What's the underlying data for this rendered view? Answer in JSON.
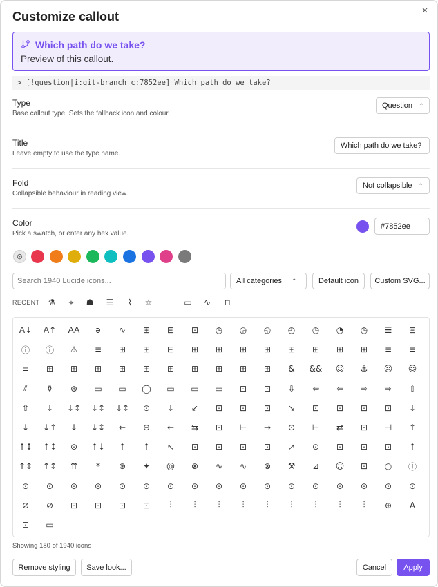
{
  "dialog": {
    "title": "Customize callout",
    "close_glyph": "×"
  },
  "preview": {
    "title": "Which path do we take?",
    "body": "Preview of this callout.",
    "icon": "git-branch-icon",
    "accent": "#7852ee"
  },
  "code": "> [!question|i:git-branch c:7852ee] Which path do we take?",
  "settings": {
    "type": {
      "label": "Type",
      "desc": "Base callout type. Sets the fallback icon and colour.",
      "value": "Question"
    },
    "title": {
      "label": "Title",
      "desc": "Leave empty to use the type name.",
      "value": "Which path do we take?"
    },
    "fold": {
      "label": "Fold",
      "desc": "Collapsible behaviour in reading view.",
      "value": "Not collapsible"
    },
    "color": {
      "label": "Color",
      "desc": "Pick a swatch, or enter any hex value.",
      "value": "#7852ee"
    }
  },
  "swatches": [
    "#e8374d",
    "#f07d1a",
    "#dfae0c",
    "#1ab85a",
    "#0fbfbf",
    "#1a73e0",
    "#7852ee",
    "#e0408a",
    "#7a7a7a"
  ],
  "icon_search": {
    "placeholder": "Search 1940 Lucide icons...",
    "category": "All categories",
    "default_icon": "Default icon",
    "custom_svg": "Custom SVG..."
  },
  "recent": {
    "label": "RECENT",
    "glyphs": [
      "⚗",
      "⌖",
      "☗",
      "☰",
      "⌇",
      "☆",
      "▭",
      "∿",
      "⊓"
    ]
  },
  "grid_glyphs": [
    "A↓",
    "A↑",
    "AA",
    "ə",
    "∿",
    "⊞",
    "⊟",
    "⊡",
    "◷",
    "◶",
    "◵",
    "◴",
    "◷",
    "◔",
    "◷",
    "☰",
    "⊟",
    "ⓘ",
    "ⓘ",
    "⚠",
    "≡",
    "⊞",
    "⊞",
    "⊟",
    "⊞",
    "⊞",
    "⊞",
    "⊞",
    "⊞",
    "⊞",
    "⊞",
    "⊞",
    "≡",
    "≡",
    "≡",
    "⊞",
    "⊞",
    "⊞",
    "⊞",
    "⊞",
    "⊞",
    "⊞",
    "⊞",
    "⊞",
    "⊞",
    "&",
    "&&",
    "☺",
    "⚓",
    "☹",
    "☺",
    "⫽",
    "⚱",
    "⊛",
    "▭",
    "▭",
    "◯",
    "▭",
    "▭",
    "▭",
    "⊡",
    "⊡",
    "⇩",
    "⇦",
    "⇦",
    "⇨",
    "⇨",
    "⇧",
    "⇧",
    "↓",
    "↓↕",
    "↓↕",
    "↓↕",
    "⊙",
    "↓",
    "↙",
    "⊡",
    "⊡",
    "⊡",
    "↘",
    "⊡",
    "⊡",
    "⊡",
    "⊡",
    "↓",
    "↓",
    "↓↑",
    "↓",
    "↓↕",
    "←",
    "⊖",
    "←",
    "⇆",
    "⊡",
    "⊢",
    "→",
    "⊙",
    "⊢",
    "⇄",
    "⊡",
    "⊣",
    "↑",
    "↑↕",
    "↑↕",
    "⊙",
    "↑↓",
    "↑",
    "↑",
    "↖",
    "⊡",
    "⊡",
    "⊡",
    "⊡",
    "↗",
    "⊙",
    "⊡",
    "⊡",
    "⊡",
    "↑",
    "↑↕",
    "↑↕",
    "⇈",
    "*",
    "⊛",
    "✦",
    "@",
    "⊗",
    "∿",
    "∿",
    "⊗",
    "⚒",
    "⊿",
    "☺",
    "⊡",
    "○",
    "ⓘ",
    "⊙",
    "⊙",
    "⊙",
    "⊙",
    "⊙",
    "⊙",
    "⊙",
    "⊙",
    "⊙",
    "⊙",
    "⊙",
    "⊙",
    "⊙",
    "⊙",
    "⊙",
    "⊙",
    "⊙",
    "⊘",
    "⊘",
    "⊡",
    "⊡",
    "⊡",
    "⊡",
    "⫶",
    "⫶",
    "⫶",
    "⫶",
    "⫶",
    "⫶",
    "⫶",
    "⫶",
    "⫶",
    "⊕",
    "A",
    "⊡",
    "▭"
  ],
  "grid_icon_names": [
    "a-arrow-down-icon",
    "a-arrow-up-icon",
    "a-large-small-icon",
    "accessibility-icon",
    "activity-icon",
    "square-activity-icon",
    "air-vent-icon",
    "airplay-icon",
    "alarm-clock-check-icon",
    "alarm-clock-icon",
    "alarm-clock-minus-icon",
    "alarm-clock-off-icon",
    "alarm-clock-plus-icon",
    "alarm-minus-icon",
    "alarm-plus-icon",
    "album-icon",
    "album-icon",
    "alert-circle-icon",
    "alert-octagon-icon",
    "alert-triangle-icon",
    "align-center-icon",
    "align-center-horizontal-icon",
    "align-center-vertical-icon",
    "align-end-horizontal-icon",
    "align-end-vertical-icon",
    "align-horizontal-distribute-center-icon",
    "align-horizontal-distribute-end-icon",
    "align-horizontal-distribute-start-icon",
    "align-horizontal-justify-center-icon",
    "align-horizontal-justify-end-icon",
    "align-horizontal-justify-start-icon",
    "align-horizontal-space-around-icon",
    "align-justify-icon",
    "align-left-icon",
    "align-right-icon",
    "align-start-horizontal-icon",
    "align-start-vertical-icon",
    "align-vertical-distribute-center-icon",
    "align-vertical-distribute-end-icon",
    "align-vertical-distribute-start-icon",
    "align-vertical-justify-center-icon",
    "align-vertical-justify-end-icon",
    "align-vertical-justify-start-icon",
    "align-vertical-space-around-icon",
    "ambulance-icon",
    "ampersand-icon",
    "ampersands-icon",
    "amphora-icon",
    "anchor-icon",
    "angry-icon",
    "annoyed-icon",
    "antenna-icon",
    "anvil-icon",
    "aperture-icon",
    "app-window-icon",
    "app-window-mac-icon",
    "apple-icon",
    "archive-icon",
    "archive-restore-icon",
    "archive-x-icon",
    "area-chart-icon",
    "armchair-icon",
    "arrow-big-down-icon",
    "arrow-big-left-icon",
    "arrow-big-left-dash-icon",
    "arrow-big-right-icon",
    "arrow-big-right-dash-icon",
    "arrow-big-up-icon",
    "arrow-big-up-dash-icon",
    "arrow-down-icon",
    "arrow-down-0-1-icon",
    "arrow-down-1-0-icon",
    "arrow-down-a-z-icon",
    "arrow-down-circle-icon",
    "arrow-down-from-line-icon",
    "arrow-down-left-icon",
    "arrow-down-left-from-circle-icon",
    "arrow-down-left-from-square-icon",
    "arrow-down-left-square-icon",
    "arrow-down-right-icon",
    "arrow-down-right-from-circle-icon",
    "arrow-down-right-from-square-icon",
    "arrow-down-right-square-icon",
    "arrow-down-square-icon",
    "arrow-down-to-dot-icon",
    "arrow-down-to-line-icon",
    "arrow-down-up-icon",
    "arrow-down-wide-narrow-icon",
    "arrow-down-z-a-icon",
    "arrow-left-icon",
    "arrow-left-circle-icon",
    "arrow-left-from-line-icon",
    "arrow-left-right-icon",
    "arrow-left-square-icon",
    "arrow-left-to-line-icon",
    "arrow-right-icon",
    "arrow-right-circle-icon",
    "arrow-right-from-line-icon",
    "arrow-right-left-icon",
    "arrow-right-square-icon",
    "arrow-right-to-line-icon",
    "arrow-up-icon",
    "arrow-up-0-1-icon",
    "arrow-up-1-0-icon",
    "arrow-up-circle-icon",
    "arrow-up-down-icon",
    "arrow-up-from-dot-icon",
    "arrow-up-from-line-icon",
    "arrow-up-left-icon",
    "arrow-up-left-from-circle-icon",
    "arrow-up-left-from-square-icon",
    "arrow-up-left-square-icon",
    "arrow-up-narrow-wide-icon",
    "arrow-up-right-icon",
    "arrow-up-right-from-circle-icon",
    "arrow-up-right-from-square-icon",
    "arrow-up-right-square-icon",
    "arrow-up-square-icon",
    "arrow-up-to-line-icon",
    "arrow-up-wide-narrow-icon",
    "arrow-up-z-a-icon",
    "arrows-up-from-line-icon",
    "asterisk-icon",
    "asterisk-square-icon",
    "astroid-icon",
    "at-sign-icon",
    "atom-icon",
    "audio-lines-icon",
    "audio-waveform-icon",
    "award-icon",
    "axe-icon",
    "axis-3d-icon",
    "baby-icon",
    "backpack-icon",
    "badge-icon",
    "badge-alert-icon",
    "badge-cent-icon",
    "badge-check-icon",
    "badge-dollar-sign-icon",
    "badge-euro-icon",
    "badge-help-icon",
    "badge-indian-rupee-icon",
    "badge-info-icon",
    "badge-japanese-yen-icon",
    "badge-minus-icon",
    "badge-percent-icon",
    "badge-plus-icon",
    "badge-pound-sterling-icon",
    "badge-question-mark-icon",
    "badge-russian-ruble-icon",
    "badge-swiss-franc-icon",
    "badge-turkish-lira-icon",
    "badge-x-icon",
    "baggage-claim-icon",
    "balloon-icon",
    "ban-icon",
    "banana-icon",
    "bandage-icon",
    "banknote-icon",
    "banknote-arrow-down-icon",
    "banknote-arrow-up-icon",
    "banknote-x-icon",
    "bar-chart-icon",
    "bar-chart-2-icon",
    "bar-chart-3-icon",
    "bar-chart-4-icon",
    "bar-chart-big-icon",
    "bar-chart-horizontal-icon",
    "barcode-icon",
    "baseline-icon",
    "bath-icon",
    "battery-icon",
    "globe-icon",
    "a-letter-icon",
    "bath-tub-icon",
    "battery-empty-icon"
  ],
  "footer": {
    "count": "Showing 180 of 1940 icons",
    "remove_styling": "Remove styling",
    "save_look": "Save look...",
    "cancel": "Cancel",
    "apply": "Apply"
  }
}
